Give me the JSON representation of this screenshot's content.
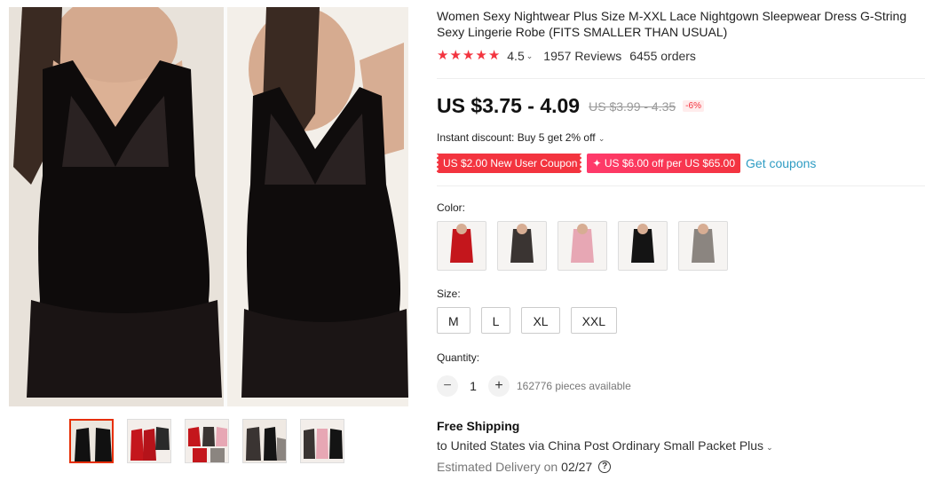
{
  "product": {
    "title": "Women Sexy Nightwear Plus Size M-XXL Lace Nightgown Sleepwear Dress G-String Sexy Lingerie Robe (FITS SMALLER THAN USUAL)"
  },
  "rating": {
    "stars": 4.5,
    "value": "4.5",
    "reviews": "1957 Reviews",
    "orders": "6455 orders"
  },
  "price": {
    "current": "US $3.75 - 4.09",
    "original": "US $3.99 - 4.35",
    "discount": "-6%"
  },
  "promo": {
    "instant_discount": "Instant discount: Buy 5 get 2% off",
    "new_user_coupon": "US $2.00 New User Coupon",
    "store_coupon": "US $6.00 off per US $65.00",
    "get_coupons": "Get coupons"
  },
  "color": {
    "label": "Color:",
    "options": [
      {
        "name": "red",
        "hex": "#c4161c"
      },
      {
        "name": "black-grey",
        "hex": "#3a3432"
      },
      {
        "name": "pink",
        "hex": "#e7a7b4"
      },
      {
        "name": "black",
        "hex": "#141414"
      },
      {
        "name": "grey",
        "hex": "#8b8580"
      }
    ]
  },
  "size": {
    "label": "Size:",
    "options": [
      "M",
      "L",
      "XL",
      "XXL"
    ]
  },
  "quantity": {
    "label": "Quantity:",
    "value": "1",
    "available": "162776 pieces available"
  },
  "shipping": {
    "title": "Free Shipping",
    "destination": "to United States via China Post Ordinary Small Packet Plus",
    "delivery_label": "Estimated Delivery on",
    "delivery_date": "02/27"
  },
  "colors": {
    "accent": "#f3343f",
    "link": "#2e9cc3"
  }
}
